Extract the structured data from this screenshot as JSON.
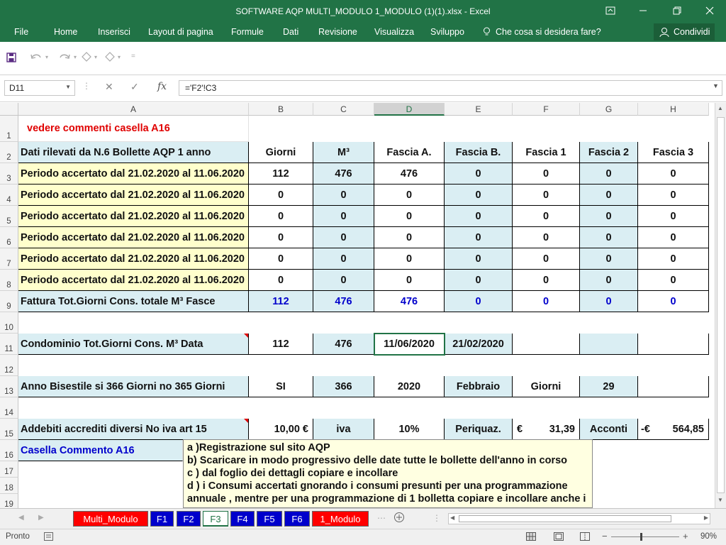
{
  "window": {
    "title": "SOFTWARE AQP MULTI_MODULO 1_MODULO (1)(1).xlsx - Excel"
  },
  "ribbon": {
    "tabs": [
      "File",
      "Home",
      "Inserisci",
      "Layout di pagina",
      "Formule",
      "Dati",
      "Revisione",
      "Visualizza",
      "Sviluppo"
    ],
    "tell_me": "Che cosa si desidera fare?",
    "share": "Condividi"
  },
  "formula_bar": {
    "name_box": "D11",
    "formula": "='F2'!C3"
  },
  "columns": [
    "A",
    "B",
    "C",
    "D",
    "E",
    "F",
    "G",
    "H"
  ],
  "rows": [
    "1",
    "2",
    "3",
    "4",
    "5",
    "6",
    "7",
    "8",
    "9",
    "10",
    "11",
    "12",
    "13",
    "14",
    "15",
    "16",
    "17",
    "18",
    "19"
  ],
  "sheet": {
    "r1": {
      "a": "vedere commenti casella A16"
    },
    "r2": {
      "a": "Dati rilevati da N.6 Bollette AQP  1 anno",
      "b": "Giorni",
      "c": "M³",
      "d": "Fascia A.",
      "e": "Fascia B.",
      "f": "Fascia 1",
      "g": "Fascia 2",
      "h": "Fascia 3"
    },
    "periods": [
      {
        "a": "Periodo accertato dal 21.02.2020 al 11.06.2020",
        "b": "112",
        "c": "476",
        "d": "476",
        "e": "0",
        "f": "0",
        "g": "0",
        "h": "0"
      },
      {
        "a": "Periodo accertato dal 21.02.2020 al 11.06.2020",
        "b": "0",
        "c": "0",
        "d": "0",
        "e": "0",
        "f": "0",
        "g": "0",
        "h": "0"
      },
      {
        "a": "Periodo accertato dal 21.02.2020 al 11.06.2020",
        "b": "0",
        "c": "0",
        "d": "0",
        "e": "0",
        "f": "0",
        "g": "0",
        "h": "0"
      },
      {
        "a": "Periodo accertato dal 21.02.2020 al 11.06.2020",
        "b": "0",
        "c": "0",
        "d": "0",
        "e": "0",
        "f": "0",
        "g": "0",
        "h": "0"
      },
      {
        "a": "Periodo accertato dal 21.02.2020 al 11.06.2020",
        "b": "0",
        "c": "0",
        "d": "0",
        "e": "0",
        "f": "0",
        "g": "0",
        "h": "0"
      },
      {
        "a": "Periodo accertato dal 21.02.2020 al 11.06.2020",
        "b": "0",
        "c": "0",
        "d": "0",
        "e": "0",
        "f": "0",
        "g": "0",
        "h": "0"
      }
    ],
    "r9": {
      "a": "Fattura Tot.Giorni  Cons. totale M³  Fasce",
      "b": "112",
      "c": "476",
      "d": "476",
      "e": "0",
      "f": "0",
      "g": "0",
      "h": "0"
    },
    "r11": {
      "a": "Condominio Tot.Giorni Cons. M³ Data",
      "b": "112",
      "c": "476",
      "d": "11/06/2020",
      "e": "21/02/2020"
    },
    "r13": {
      "a": "Anno Bisestile si 366 Giorni no 365 Giorni",
      "b": "SI",
      "c": "366",
      "d": "2020",
      "e": "Febbraio",
      "f": "Giorni",
      "g": "29"
    },
    "r15": {
      "a": "Addebiti accrediti diversi  No iva  art 15",
      "b": "10,00 €",
      "c": "iva",
      "d": "10%",
      "e": "Periquaz.",
      "f_cur": "€",
      "f": "31,39",
      "g": "Acconti",
      "h_cur": "-€",
      "h": "564,85"
    },
    "r16": {
      "a": "Casella Commento A16"
    }
  },
  "comment": {
    "lines": [
      "a )Registrazione sul sito AQP",
      "b) Scaricare  in modo progressivo delle date tutte le bollette dell'anno in corso",
      "c ) dal foglio dei dettagli copiare e incollare",
      "d ) i Consumi accertati gnorando i consumi presunti per una programmazione",
      "annuale , mentre per una programmazione di 1 bolletta copiare e incollare anche i"
    ]
  },
  "sheet_tabs": [
    {
      "label": "Multi_Modulo",
      "color": "#ff0000"
    },
    {
      "label": "F1",
      "color": "#0000cc"
    },
    {
      "label": "F2",
      "color": "#0000cc"
    },
    {
      "label": "F3",
      "color": "#ffffff",
      "active": true
    },
    {
      "label": "F4",
      "color": "#0000cc"
    },
    {
      "label": "F5",
      "color": "#0000cc"
    },
    {
      "label": "F6",
      "color": "#0000cc"
    },
    {
      "label": "1_Modulo",
      "color": "#ff0000"
    }
  ],
  "status": {
    "ready": "Pronto",
    "zoom": "90%"
  },
  "colors": {
    "accent": "#217346",
    "yellow_fill": "#ffffcc",
    "blue_fill": "#daeef3",
    "blue_text": "#0000cc",
    "red_text": "#e00000"
  }
}
